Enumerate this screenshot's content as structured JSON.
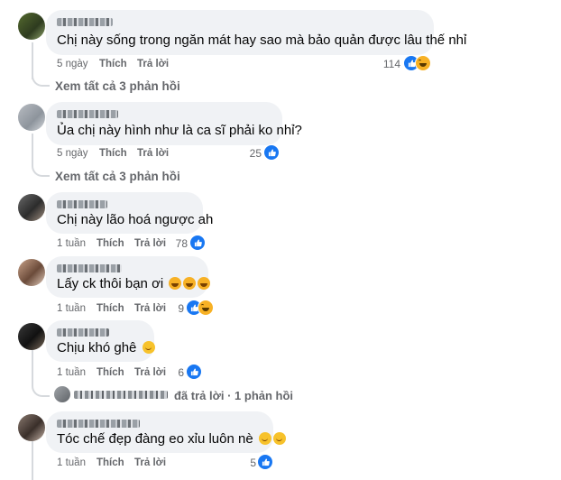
{
  "comments": [
    {
      "text": "Chị này sống trong ngăn mát hay sao mà bảo quản được lâu thế nhỉ",
      "time": "5 ngày",
      "like_label": "Thích",
      "reply_label": "Trả lời",
      "reaction_count": "114",
      "reactions": [
        "like-icon",
        "haha-icon"
      ],
      "view_replies": "Xem tất cả 3 phản hồi"
    },
    {
      "text": "Ủa chị này hình như là ca sĩ phải ko nhỉ?",
      "time": "5 ngày",
      "like_label": "Thích",
      "reply_label": "Trả lời",
      "reaction_count": "25",
      "reactions": [
        "like-icon"
      ],
      "view_replies": "Xem tất cả 3 phản hồi"
    },
    {
      "text": "Chị này lão hoá ngược ah",
      "time": "1 tuần",
      "like_label": "Thích",
      "reply_label": "Trả lời",
      "reaction_count": "78",
      "reactions": [
        "like-icon"
      ]
    },
    {
      "text": "Lấy ck thôi bạn ơi",
      "time": "1 tuần",
      "like_label": "Thích",
      "reply_label": "Trả lời",
      "reaction_count": "9",
      "reactions": [
        "like-icon",
        "haha-icon"
      ]
    },
    {
      "text": "Chịu khó ghê",
      "time": "1 tuần",
      "like_label": "Thích",
      "reply_label": "Trả lời",
      "reaction_count": "6",
      "reactions": [
        "like-icon"
      ],
      "reply_summary": "đã trả lời · 1 phản hồi"
    },
    {
      "text": "Tóc chế đẹp đàng eo xỉu luôn nè",
      "time": "1 tuần",
      "like_label": "Thích",
      "reply_label": "Trả lời",
      "reaction_count": "5",
      "reactions": [
        "like-icon"
      ]
    }
  ],
  "colors": {
    "bubble": "#f0f2f5",
    "meta": "#65676b",
    "like_blue": "#1877f2",
    "haha_yellow": "#f7b125"
  }
}
